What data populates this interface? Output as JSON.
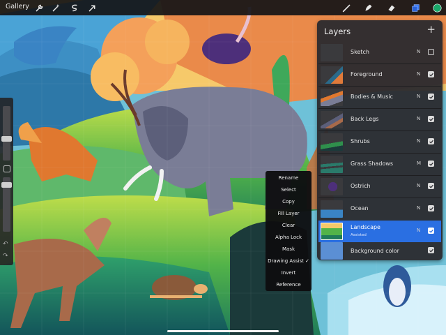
{
  "topbar": {
    "gallery_label": "Gallery",
    "left_tools": [
      "wrench-icon",
      "magic-wand-icon",
      "selection-icon",
      "transform-arrow-icon"
    ],
    "right_tools": [
      "brush-icon",
      "smudge-icon",
      "eraser-icon",
      "layers-icon",
      "color-swatch-icon"
    ],
    "active_color": "#1aa86a",
    "accent": "#3b7bf5"
  },
  "context_menu": {
    "items": [
      "Rename",
      "Select",
      "Copy",
      "Fill Layer",
      "Clear",
      "Alpha Lock",
      "Mask",
      "Drawing Assist ✓",
      "Invert",
      "Reference"
    ]
  },
  "layers_panel": {
    "title": "Layers",
    "add_label": "+",
    "layers": [
      {
        "name": "Sketch",
        "blend": "N",
        "visible": false,
        "active": false
      },
      {
        "name": "Foreground",
        "blend": "N",
        "visible": true,
        "active": false
      },
      {
        "name": "Bodies & Music",
        "blend": "N",
        "visible": true,
        "active": false
      },
      {
        "name": "Back Legs",
        "blend": "N",
        "visible": true,
        "active": false
      },
      {
        "name": "Shrubs",
        "blend": "N",
        "visible": true,
        "active": false
      },
      {
        "name": "Grass Shadows",
        "blend": "M",
        "visible": true,
        "active": false
      },
      {
        "name": "Ostrich",
        "blend": "N",
        "visible": true,
        "active": false
      },
      {
        "name": "Ocean",
        "blend": "N",
        "visible": true,
        "active": false
      },
      {
        "name": "Landscape",
        "sub": "Assisted",
        "blend": "N",
        "visible": true,
        "active": true
      }
    ],
    "background": {
      "name": "Background color",
      "visible": true,
      "color": "#5b8fd4"
    }
  },
  "sidebar": {
    "undo_icon": "undo-icon",
    "redo_icon": "redo-icon"
  }
}
